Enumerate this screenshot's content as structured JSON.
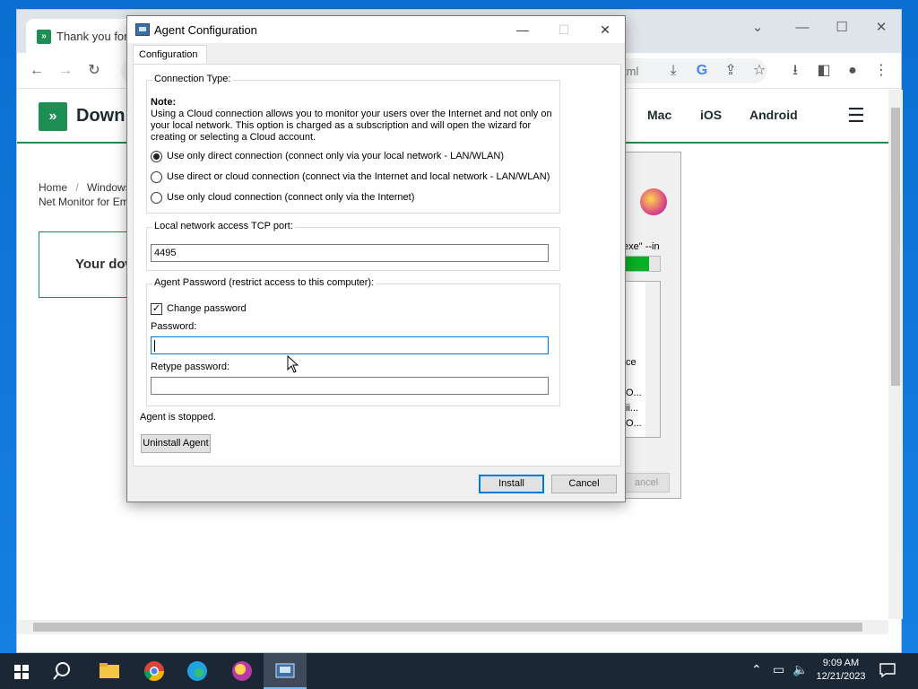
{
  "browser": {
    "tab_title": "Thank you for c",
    "tab_favicon": "download-site-favicon",
    "url_fragment": "tml",
    "site_logo_text": "Down",
    "nav": [
      "Mac",
      "iOS",
      "Android"
    ],
    "breadcrumb_home": "Home",
    "breadcrumb_sep": "/",
    "breadcrumb_windows": "Windows",
    "breadcrumb_line2": "Net Monitor for Em",
    "download_text": "Your dow"
  },
  "installer_bg": {
    "cmd_text": "exe\" --in",
    "progress": 0.7,
    "list_lines": [
      "ce",
      "O...",
      "ii...",
      "O..."
    ],
    "cancel_label": "ancel"
  },
  "dialog": {
    "title": "Agent Configuration",
    "tab_label": "Configuration",
    "connection": {
      "legend": "Connection Type:",
      "note_title": "Note:",
      "note_body": "Using a Cloud connection allows you to monitor your users over the Internet and not only on your local network. This option is charged as a subscription and will open the wizard for creating or selecting a Cloud account.",
      "options": [
        {
          "label": "Use only direct connection (connect only via your local network - LAN/WLAN)",
          "checked": true
        },
        {
          "label": "Use direct or cloud connection (connect via the Internet and local network - LAN/WLAN)",
          "checked": false
        },
        {
          "label": "Use only cloud connection (connect only via the Internet)",
          "checked": false
        }
      ]
    },
    "port": {
      "legend": "Local network access TCP port:",
      "value": "4495"
    },
    "password": {
      "legend": "Agent Password (restrict access to this computer):",
      "change_label": "Change password",
      "change_checked": true,
      "password_label": "Password:",
      "password_value": "",
      "retype_label": "Retype password:",
      "retype_value": ""
    },
    "status": "Agent is stopped.",
    "uninstall_label": "Uninstall Agent",
    "install_label": "Install",
    "cancel_label": "Cancel"
  },
  "taskbar": {
    "time": "9:09 AM",
    "date": "12/21/2023"
  },
  "colors": {
    "accent": "#0078d7",
    "site_green": "#1e8f52",
    "progress_green": "#06b025"
  }
}
